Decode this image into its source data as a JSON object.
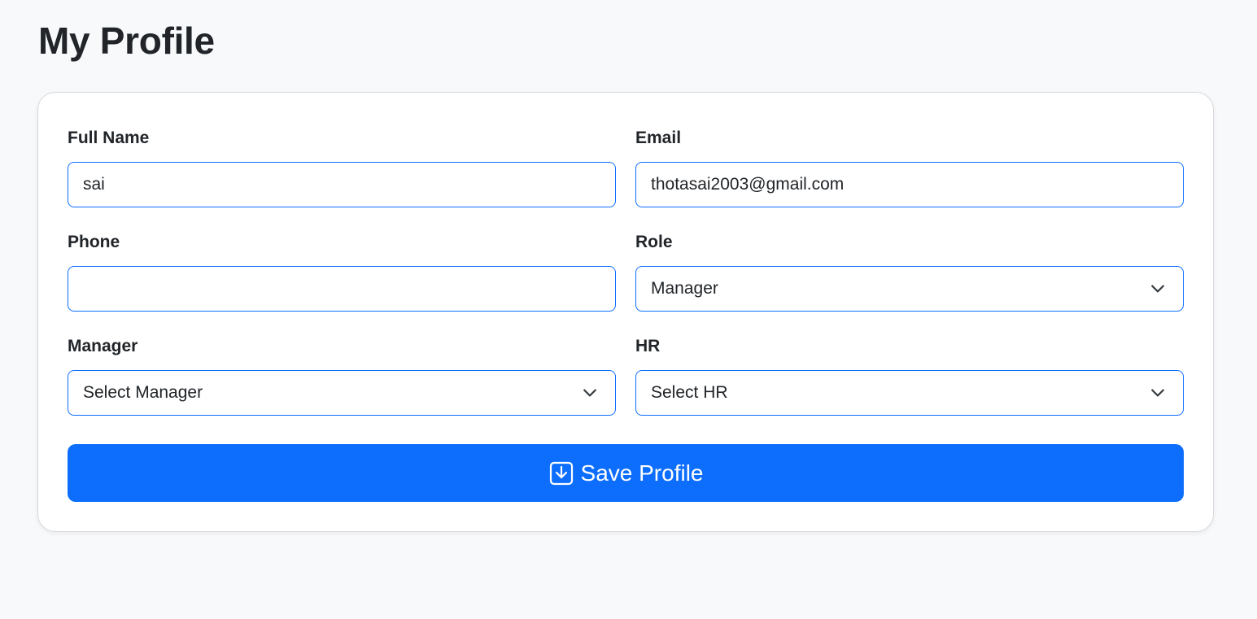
{
  "page": {
    "title": "My Profile"
  },
  "form": {
    "full_name": {
      "label": "Full Name",
      "value": "sai",
      "placeholder": ""
    },
    "email": {
      "label": "Email",
      "value": "thotasai2003@gmail.com",
      "placeholder": ""
    },
    "phone": {
      "label": "Phone",
      "value": "",
      "placeholder": ""
    },
    "role": {
      "label": "Role",
      "selected": "Manager",
      "icon": "chevron-down-icon"
    },
    "manager": {
      "label": "Manager",
      "selected": "Select Manager",
      "icon": "chevron-down-icon"
    },
    "hr": {
      "label": "HR",
      "selected": "Select HR",
      "icon": "chevron-down-icon"
    },
    "save_button": {
      "label": "Save Profile",
      "icon": "download-icon"
    }
  },
  "colors": {
    "accent": "#0d6efd",
    "page_background": "#f8f9fa",
    "card_background": "#ffffff",
    "text": "#212529"
  }
}
